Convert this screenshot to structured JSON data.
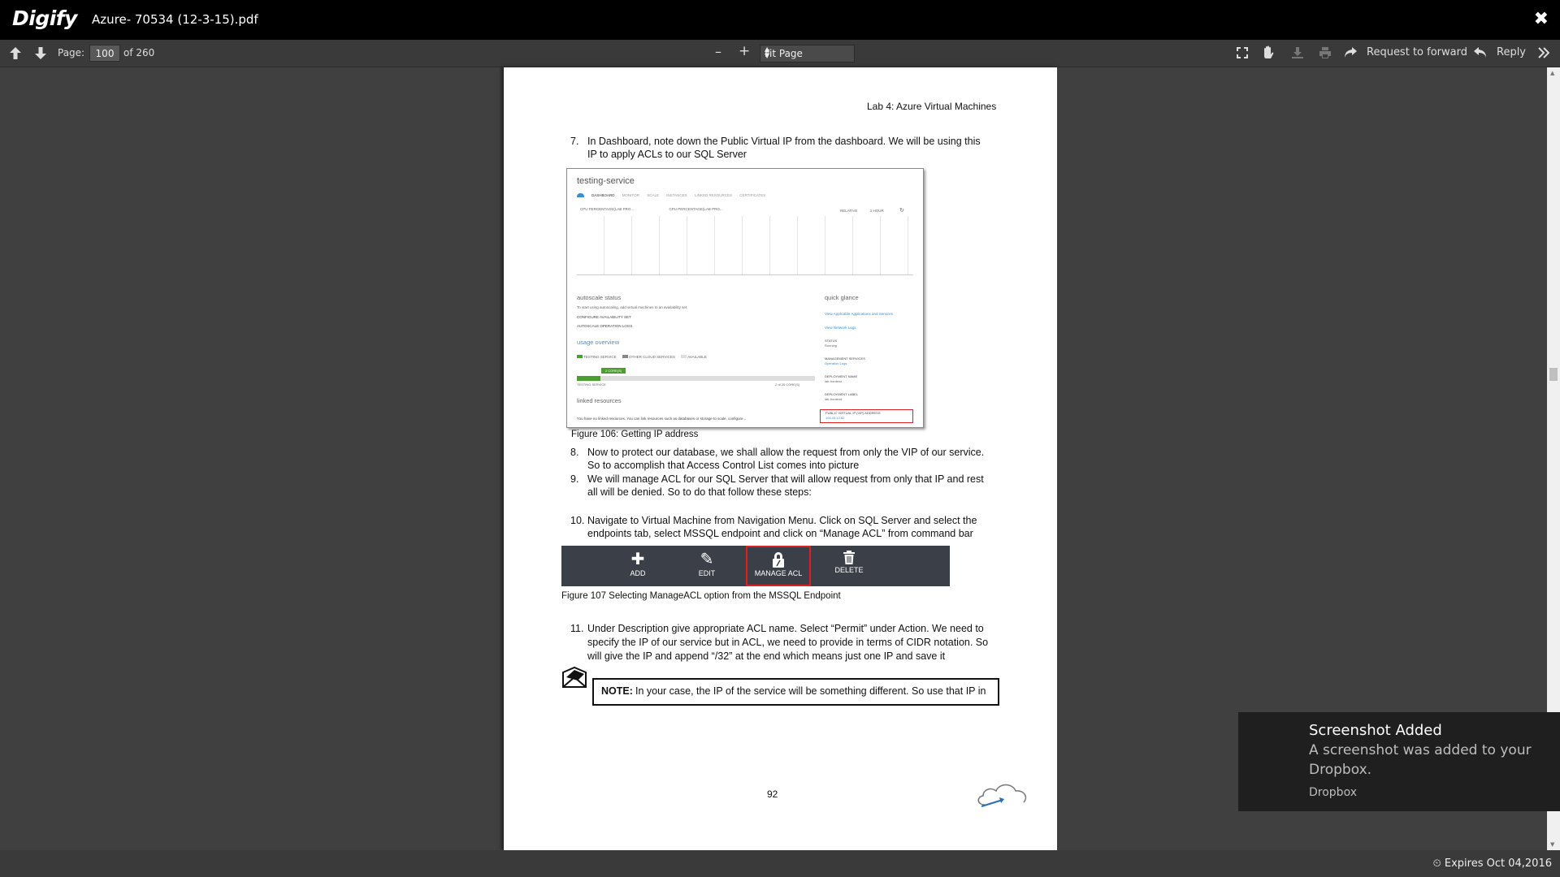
{
  "app": {
    "logo": "Digify",
    "doc_title": "Azure- 70534 (12-3-15).pdf",
    "close": "✖"
  },
  "toolbar": {
    "page_label": "Page:",
    "page_value": "100",
    "page_total": "of 260",
    "zoom_minus": "–",
    "zoom_plus": "+",
    "zoom_value": "Fit Page",
    "request_forward": "Request to forward",
    "reply": "Reply"
  },
  "document": {
    "header": "Lab 4: Azure Virtual Machines",
    "step7_num": "7.",
    "step7": [
      "In Dashboard, note down the Public Virtual IP from the dashboard. We will be using this",
      "IP to apply ACLs to our SQL Server"
    ],
    "screenshot": {
      "title": "testing-service",
      "tabs": [
        "DASHBOARD",
        "MONITOR",
        "SCALE",
        "INSTANCES",
        "LINKED RESOURCES",
        "CERTIFICATES"
      ],
      "legend": [
        "CPU PERCENTAGE(LAB PRO...",
        "CPU PERCENTAGE(LAB PRO..."
      ],
      "range": [
        "RELATIVE",
        "1 HOUR"
      ],
      "autoscale_title": "autoscale status",
      "autoscale_text": "To start using autoscaling, add virtual machines to an availability set.",
      "autoscale_links": [
        "CONFIGURE AVAILABILITY SET",
        "AUTOSCALE OPERATION LOGS"
      ],
      "usage_title": "usage overview",
      "usage_legend": [
        "TESTING SERVICE",
        "OTHER CLOUD SERVICES",
        "AVAILABLE"
      ],
      "usage_cores": "2 CORE(S)",
      "usage_service": "TESTING SERVICE",
      "usage_total": "2 of 20 CORE(S)",
      "linked_title": "linked resources",
      "linked_text": "You have no linked resources. You can link resources such as databases or storage to scale, configure...",
      "glance_title": "quick glance",
      "glance_links": [
        "View Applicable Applications and Services",
        "View Network Logs"
      ],
      "glance_items": [
        {
          "k": "STATUS",
          "v": "Running"
        },
        {
          "k": "MANAGEMENT SERVICES",
          "v": "Operation Logs"
        },
        {
          "k": "DEPLOYMENT NAME",
          "v": "lab-frontend"
        },
        {
          "k": "DEPLOYMENT LABEL",
          "v": "lab-frontend"
        }
      ],
      "vip_label": "PUBLIC VIRTUAL IP (VIP) ADDRESS",
      "vip_value": "104.43.10.82"
    },
    "fig106": "Figure 106: Getting IP address",
    "step8_num": "8.",
    "step8": [
      "Now to protect our database, we shall allow the request from only the VIP of our service.",
      "So to accomplish that Access Control List comes into picture"
    ],
    "step9_num": "9.",
    "step9": [
      "We will manage ACL for our SQL Server that will allow request from only that IP and rest",
      "all will be denied. So to do that follow these steps:"
    ],
    "step10_num": "10.",
    "step10": [
      "Navigate to Virtual Machine from Navigation Menu. Click on SQL Server and select the",
      "endpoints tab, select MSSQL endpoint and click on “Manage ACL” from command bar"
    ],
    "cmdbar": {
      "add": "ADD",
      "edit": "EDIT",
      "manage_acl": "MANAGE ACL",
      "delete": "DELETE"
    },
    "fig107": "Figure 107 Selecting ManageACL option from the MSSQL Endpoint",
    "step11_num": "11.",
    "step11": [
      "Under Description give appropriate ACL name. Select “Permit” under Action. We need to",
      "specify the IP of our service but in ACL, we need to provide in terms of CIDR notation. So",
      "will give the IP and append “/32” at the end which means just one IP and save it"
    ],
    "note_label": "NOTE:",
    "note_text": "In your case, the IP of the service will be something different. So use that IP in",
    "page_number": "92"
  },
  "toast": {
    "title": "Screenshot Added",
    "body": [
      "A screenshot was added to your",
      "Dropbox."
    ],
    "app": "Dropbox"
  },
  "status": {
    "expires": "Expires Oct 04,2016"
  }
}
